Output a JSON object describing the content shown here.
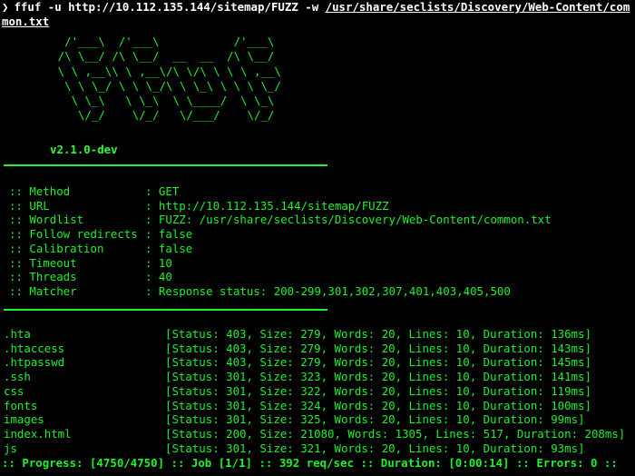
{
  "command": {
    "prompt_icon": "❯",
    "text": "ffuf -u http://10.112.135.144/sitemap/FUZZ -w ",
    "wordlist_path": "/usr/share/seclists/Discovery/Web-Content/common.txt"
  },
  "banner": {
    "ascii_art": "         /'___\\  /'___\\           /'___\\\n        /\\ \\__/ /\\ \\__/  __  __  /\\ \\__/\n        \\ \\ ,__\\\\ \\ ,__\\/\\ \\/\\ \\ \\ \\ ,__\\\n         \\ \\ \\_/ \\ \\ \\_/\\ \\ \\_\\ \\ \\ \\ \\_/\n          \\ \\_\\   \\ \\_\\  \\ \\____/  \\ \\_\\\n           \\/_/    \\/_/   \\/___/    \\/_/",
    "version": "v2.1.0-dev"
  },
  "config": [
    {
      "key": ":: Method",
      "value": ": GET"
    },
    {
      "key": ":: URL",
      "value": ": http://10.112.135.144/sitemap/FUZZ"
    },
    {
      "key": ":: Wordlist",
      "value": ": FUZZ: /usr/share/seclists/Discovery/Web-Content/common.txt"
    },
    {
      "key": ":: Follow redirects",
      "value": ": false"
    },
    {
      "key": ":: Calibration",
      "value": ": false"
    },
    {
      "key": ":: Timeout",
      "value": ": 10"
    },
    {
      "key": ":: Threads",
      "value": ": 40"
    },
    {
      "key": ":: Matcher",
      "value": ": Response status: 200-299,301,302,307,401,403,405,500"
    }
  ],
  "results": [
    {
      "name": ".hta",
      "status": "[Status: 403, Size: 279, Words: 20, Lines: 10, Duration: 136ms]"
    },
    {
      "name": ".htaccess",
      "status": "[Status: 403, Size: 279, Words: 20, Lines: 10, Duration: 143ms]"
    },
    {
      "name": ".htpasswd",
      "status": "[Status: 403, Size: 279, Words: 20, Lines: 10, Duration: 145ms]"
    },
    {
      "name": ".ssh",
      "status": "[Status: 301, Size: 323, Words: 20, Lines: 10, Duration: 141ms]"
    },
    {
      "name": "css",
      "status": "[Status: 301, Size: 322, Words: 20, Lines: 10, Duration: 119ms]"
    },
    {
      "name": "fonts",
      "status": "[Status: 301, Size: 324, Words: 20, Lines: 10, Duration: 100ms]"
    },
    {
      "name": "images",
      "status": "[Status: 301, Size: 325, Words: 20, Lines: 10, Duration: 99ms]"
    },
    {
      "name": "index.html",
      "status": "[Status: 200, Size: 21080, Words: 1305, Lines: 517, Duration: 208ms]"
    },
    {
      "name": "js",
      "status": "[Status: 301, Size: 321, Words: 20, Lines: 10, Duration: 93ms]"
    }
  ],
  "progress": ":: Progress: [4750/4750] :: Job [1/1] :: 392 req/sec :: Duration: [0:00:14] :: Errors: 0 ::",
  "colors": {
    "background": "#000000",
    "text_green": "#1cf22e",
    "command_white": "#ffffff"
  }
}
